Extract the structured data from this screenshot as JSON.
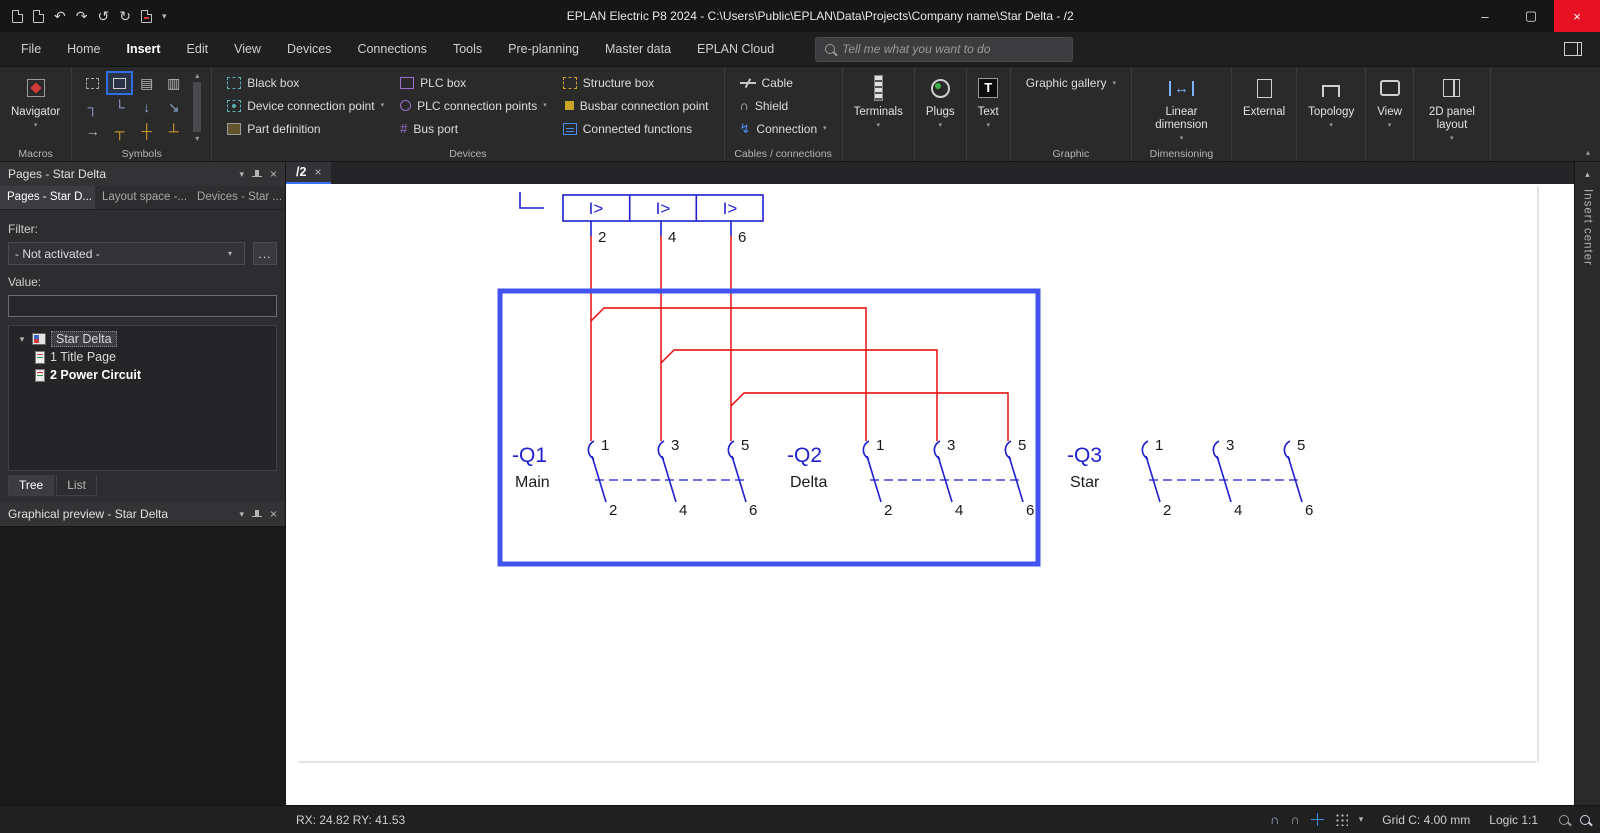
{
  "titlebar": {
    "title": "EPLAN Electric P8 2024 - C:\\Users\\Public\\EPLAN\\Data\\Projects\\Company name\\Star Delta - /2"
  },
  "menubar": {
    "tabs": [
      "File",
      "Home",
      "Insert",
      "Edit",
      "View",
      "Devices",
      "Connections",
      "Tools",
      "Pre-planning",
      "Master data",
      "EPLAN Cloud"
    ],
    "search_placeholder": "Tell me what you want to do"
  },
  "ribbon": {
    "macros": {
      "caption": "Macros",
      "navigator_label": "Navigator"
    },
    "symbols": {
      "caption": "Symbols"
    },
    "devices": {
      "caption": "Devices",
      "col1": [
        "Black box",
        "Device connection point",
        "Part definition"
      ],
      "col2": [
        "PLC box",
        "PLC connection points",
        "Bus port"
      ],
      "col3": [
        "Structure box",
        "Busbar connection point",
        "Connected functions"
      ]
    },
    "cables": {
      "caption": "Cables / connections",
      "items": [
        "Cable",
        "Shield",
        "Connection"
      ]
    },
    "big_buttons": [
      "Terminals",
      "Plugs",
      "Text"
    ],
    "graphic": {
      "caption": "Graphic",
      "gallery_label": "Graphic gallery"
    },
    "dimensioning": {
      "caption": "Dimensioning",
      "button_label": "Linear dimension"
    },
    "right_buttons": [
      "External",
      "Topology",
      "View",
      "2D panel layout"
    ]
  },
  "pages_panel": {
    "title": "Pages - Star Delta",
    "tabs": [
      "Pages - Star D...",
      "Layout space -...",
      "Devices - Star ..."
    ],
    "filter_label": "Filter:",
    "filter_value": "- Not activated -",
    "more_button": "...",
    "value_label": "Value:",
    "tree": {
      "root": "Star Delta",
      "children": [
        "1 Title Page",
        "2 Power Circuit"
      ]
    },
    "bottom_tabs": [
      "Tree",
      "List"
    ]
  },
  "preview_panel": {
    "title": "Graphical preview - Star Delta"
  },
  "editor": {
    "tab_label": "/2",
    "insert_center": "Insert center"
  },
  "schematic": {
    "relay_cells": [
      "I>",
      "I>",
      "I>"
    ],
    "relay_terminals": [
      "2",
      "4",
      "6"
    ],
    "contactors": [
      {
        "tag": "-Q1",
        "name": "Main"
      },
      {
        "tag": "-Q2",
        "name": "Delta"
      },
      {
        "tag": "-Q3",
        "name": "Star"
      }
    ],
    "pole_top": [
      "1",
      "3",
      "5"
    ],
    "pole_bottom": [
      "2",
      "4",
      "6"
    ]
  },
  "statusbar": {
    "coords": "RX: 24.82 RY: 41.53",
    "grid": "Grid C: 4.00 mm",
    "logic": "Logic 1:1"
  },
  "colors": {
    "wire_red": "#e60000",
    "symbol_blue": "#1f1fd0",
    "selection_blue": "#4253f0",
    "accent_blue": "#3574f0"
  },
  "icons": {
    "undo": "↶",
    "redo": "↷",
    "undo_all": "↺",
    "redo_all": "↻",
    "caret_down": "▾",
    "caret_up": "▴",
    "close": "×",
    "minimize": "–",
    "maximize": "▢",
    "arrow_right": "→",
    "arrow_down": "↓",
    "arrow_se": "↘",
    "corner_tl": "┐",
    "corner_bl": "└",
    "tee_down": "┬",
    "cross": "┼",
    "tee_up": "┴",
    "hatch_a": "▤",
    "hatch_b": "▥",
    "bus_port": "#",
    "shield": "∩",
    "connection": "↯",
    "text_glyph": "T",
    "dimension": "↔",
    "snap_a": "∩",
    "snap_b": "∩",
    "tree_expand": "▾"
  }
}
